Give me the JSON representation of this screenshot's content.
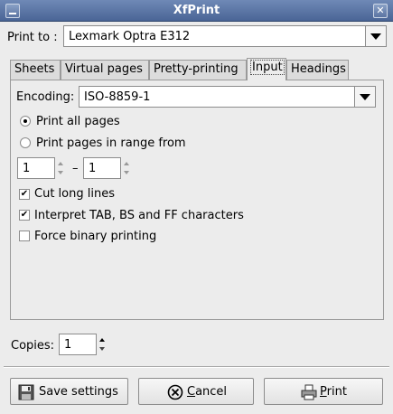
{
  "window": {
    "title": "XfPrint",
    "close_glyph": "✕"
  },
  "print_to": {
    "label": "Print to :",
    "printer": "Lexmark Optra E312"
  },
  "tabs": [
    {
      "label": "Sheets"
    },
    {
      "label": "Virtual pages"
    },
    {
      "label": "Pretty-printing"
    },
    {
      "label": "Input"
    },
    {
      "label": "Headings"
    }
  ],
  "input_tab": {
    "encoding_label": "Encoding:",
    "encoding_value": "ISO-8859-1",
    "print_all_label": "Print all pages",
    "print_all_selected": true,
    "print_range_label": "Print pages in range from",
    "range_from": "1",
    "range_separator": "–",
    "range_to": "1",
    "cut_long_lines_label": "Cut long lines",
    "cut_long_lines": true,
    "interpret_label": "Interpret TAB, BS and FF characters",
    "interpret": true,
    "force_binary_label": "Force binary printing",
    "force_binary": false
  },
  "copies": {
    "label": "Copies:",
    "value": "1"
  },
  "buttons": {
    "save_settings": "Save settings",
    "cancel_first": "C",
    "cancel_rest": "ancel",
    "print_first": "P",
    "print_rest": "rint"
  },
  "icons": {
    "save": "floppy-disk-icon",
    "cancel": "cancel-circle-icon",
    "print": "printer-icon"
  }
}
